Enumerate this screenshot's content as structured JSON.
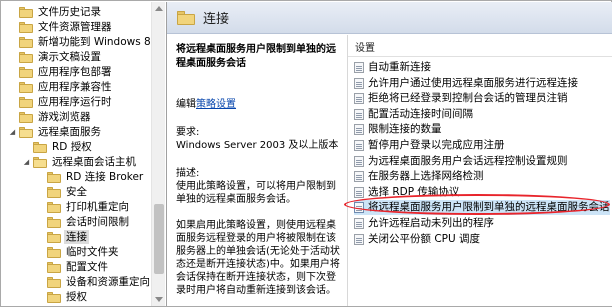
{
  "tree": {
    "items": [
      {
        "label": "文件历史记录",
        "indent": 0,
        "expander": "",
        "open": false
      },
      {
        "label": "文件资源管理器",
        "indent": 0,
        "expander": "",
        "open": false
      },
      {
        "label": "新增功能到 Windows 8",
        "indent": 0,
        "expander": "",
        "open": false
      },
      {
        "label": "演示文稿设置",
        "indent": 0,
        "expander": "",
        "open": false
      },
      {
        "label": "应用程序包部署",
        "indent": 0,
        "expander": "",
        "open": false
      },
      {
        "label": "应用程序兼容性",
        "indent": 0,
        "expander": "",
        "open": false
      },
      {
        "label": "应用程序运行时",
        "indent": 0,
        "expander": "",
        "open": false
      },
      {
        "label": "游戏浏览器",
        "indent": 0,
        "expander": "",
        "open": false
      },
      {
        "label": "远程桌面服务",
        "indent": 0,
        "expander": "◢",
        "open": true
      },
      {
        "label": "RD 授权",
        "indent": 1,
        "expander": "",
        "open": false
      },
      {
        "label": "远程桌面会话主机",
        "indent": 1,
        "expander": "◢",
        "open": true
      },
      {
        "label": "RD 连接 Broker",
        "indent": 2,
        "expander": "",
        "open": false
      },
      {
        "label": "安全",
        "indent": 2,
        "expander": "",
        "open": false
      },
      {
        "label": "打印机重定向",
        "indent": 2,
        "expander": "",
        "open": false
      },
      {
        "label": "会话时间限制",
        "indent": 2,
        "expander": "",
        "open": false
      },
      {
        "label": "连接",
        "indent": 2,
        "expander": "",
        "open": false,
        "selected": true
      },
      {
        "label": "临时文件夹",
        "indent": 2,
        "expander": "",
        "open": false
      },
      {
        "label": "配置文件",
        "indent": 2,
        "expander": "",
        "open": false
      },
      {
        "label": "设备和资源重定向",
        "indent": 2,
        "expander": "",
        "open": false
      },
      {
        "label": "授权",
        "indent": 2,
        "expander": "",
        "open": false
      }
    ]
  },
  "header": {
    "title": "连接"
  },
  "description": {
    "policy_title": "将远程桌面服务用户限制到单独的远程桌面服务会话",
    "edit_prefix": "编辑",
    "edit_link": "策略设置",
    "requirements_label": "要求:",
    "requirements_value": "Windows Server 2003 及以上版本",
    "description_label": "描述:",
    "description_text": "使用此策略设置，可以将用户限制到单独的远程桌面服务会话。",
    "paragraph2": "如果启用此策略设置，则使用远程桌面服务远程登录的用户将被限制在该服务器上的单独会话(无论处于活动状态还是断开连接状态)中。如果用户将会话保持在断开连接状态，则下次登录时用户将自动重新连接到该会话。"
  },
  "list": {
    "column_header": "设置",
    "items": [
      {
        "label": "自动重新连接",
        "selected": false
      },
      {
        "label": "允许用户通过使用远程桌面服务进行远程连接",
        "selected": false
      },
      {
        "label": "拒绝将已经登录到控制台会话的管理员注销",
        "selected": false
      },
      {
        "label": "配置活动连接时间间隔",
        "selected": false
      },
      {
        "label": "限制连接的数量",
        "selected": false
      },
      {
        "label": "暂停用户登录以完成应用注册",
        "selected": false
      },
      {
        "label": "为远程桌面服务用户会话远程控制设置规则",
        "selected": false
      },
      {
        "label": "在服务器上选择网络检测",
        "selected": false
      },
      {
        "label": "选择 RDP 传输协议",
        "selected": false
      },
      {
        "label": "将远程桌面服务用户限制到单独的远程桌面服务会话",
        "selected": true
      },
      {
        "label": "允许远程启动未列出的程序",
        "selected": false
      },
      {
        "label": "关闭公平份额 CPU 调度",
        "selected": false
      }
    ]
  },
  "colors": {
    "selection": "#cce4f7",
    "highlight_ring": "#e8242b",
    "folder": "#f1d47c",
    "header_gradient_top": "#e9eef6",
    "link": "#0645ad"
  }
}
